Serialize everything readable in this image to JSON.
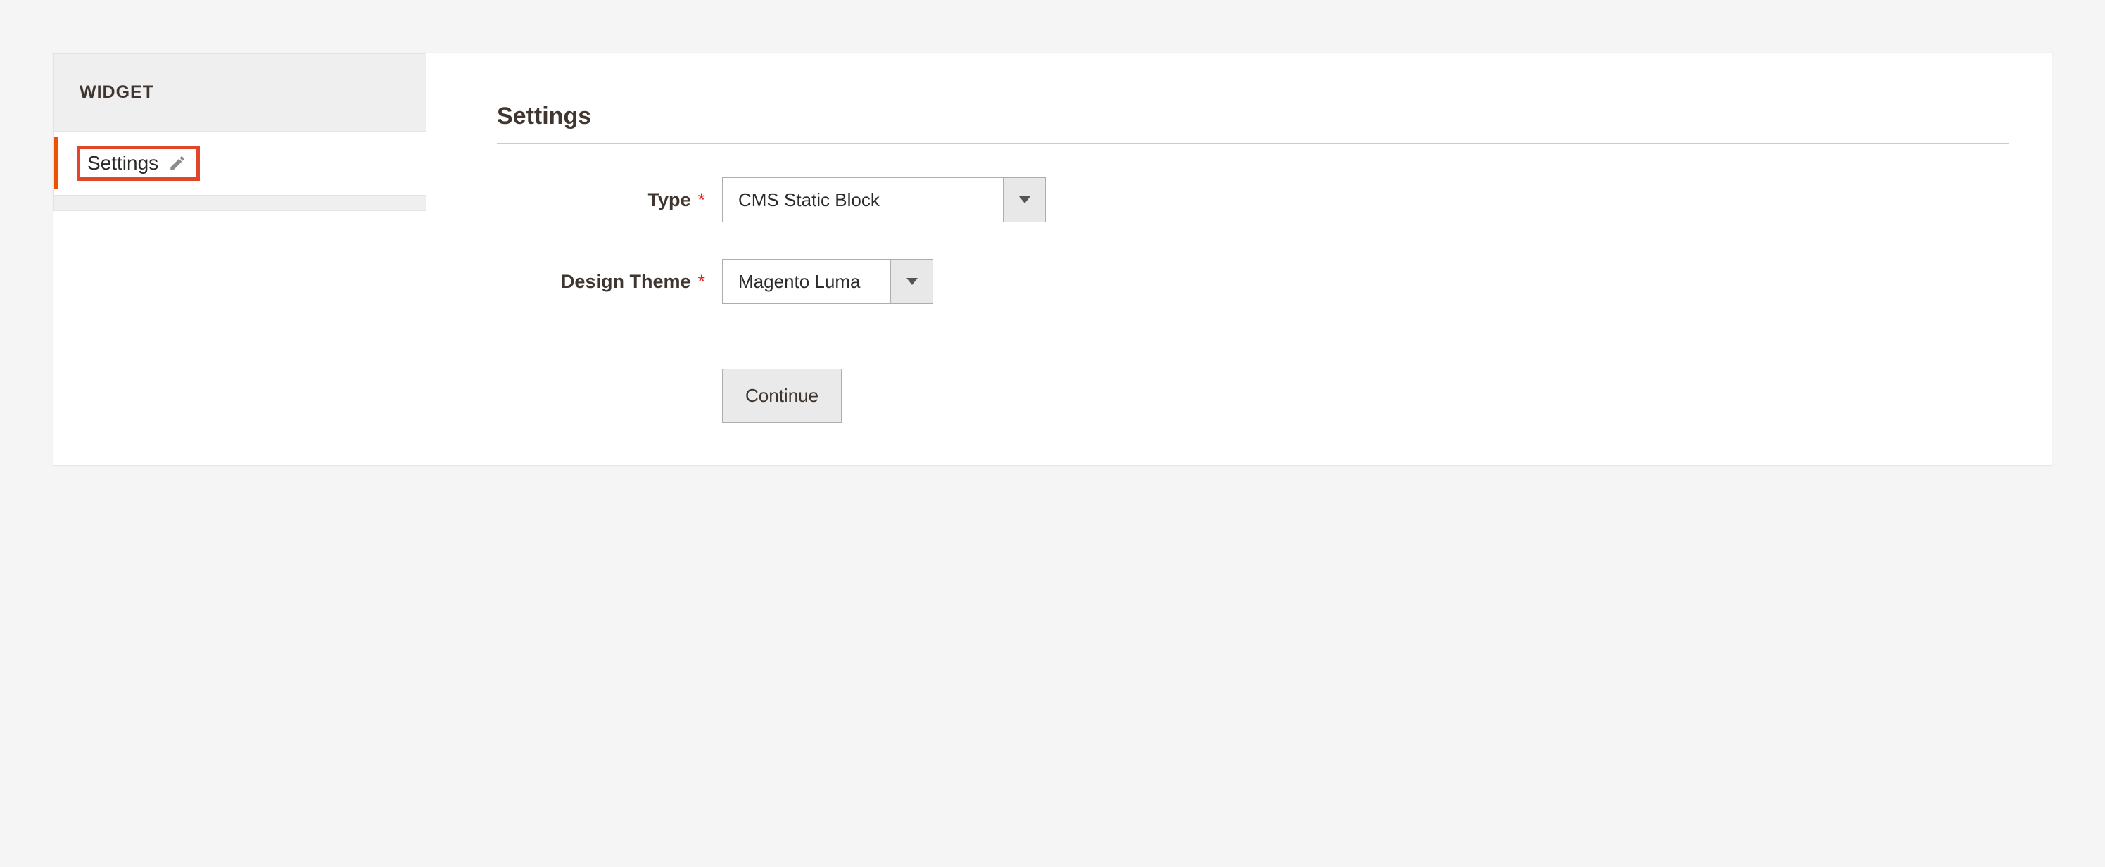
{
  "sidebar": {
    "header": "WIDGET",
    "items": [
      {
        "label": "Settings"
      }
    ]
  },
  "main": {
    "section_title": "Settings",
    "fields": {
      "type": {
        "label": "Type",
        "value": "CMS Static Block",
        "required": "*"
      },
      "design_theme": {
        "label": "Design Theme",
        "value": "Magento Luma",
        "required": "*"
      }
    },
    "buttons": {
      "continue": "Continue"
    }
  }
}
